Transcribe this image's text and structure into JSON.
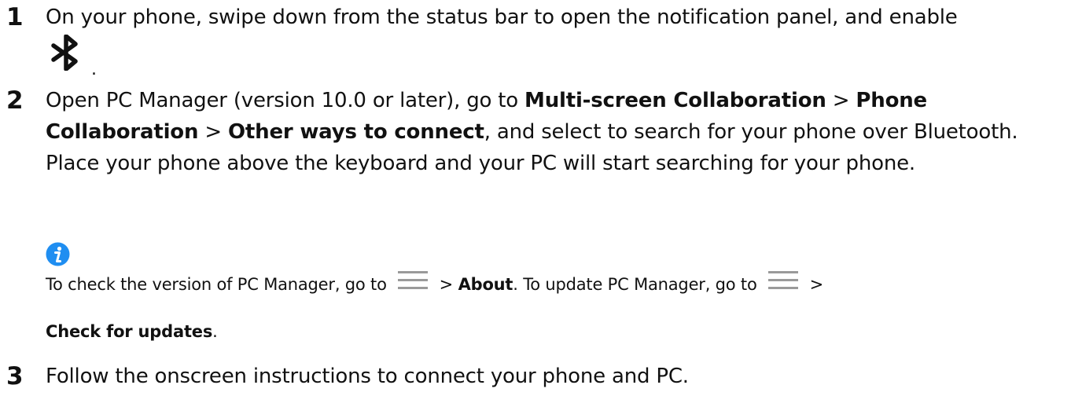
{
  "steps": [
    {
      "number": "1",
      "text": "On your phone, swipe down from the status bar to open the notification panel, and enable",
      "icon": "bluetooth-icon",
      "suffix": "."
    },
    {
      "number": "2",
      "part1": "Open PC Manager (version 10.0 or later), go to ",
      "bold1": "Multi-screen Collaboration",
      "sep1": " > ",
      "bold2": "Phone Collaboration",
      "sep2": " > ",
      "bold3": "Other ways to connect",
      "part2": ", and select to search for your phone over Bluetooth. Place your phone above the keyboard and your PC will start searching for your phone."
    },
    {
      "number": "3",
      "text": "Follow the onscreen instructions to connect your phone and PC."
    }
  ],
  "note": {
    "icon": "info-icon",
    "line1_a": "To check the version of PC Manager, go to ",
    "line1_sep1": " > ",
    "line1_bold1": "About",
    "line1_b": ". To update PC Manager, go to ",
    "line1_sep2": " >",
    "line2_bold": "Check for updates",
    "line2_end": "."
  },
  "colors": {
    "text": "#111111",
    "info_accent": "#1f8ef1",
    "menu_icon": "#9a9a9a"
  }
}
